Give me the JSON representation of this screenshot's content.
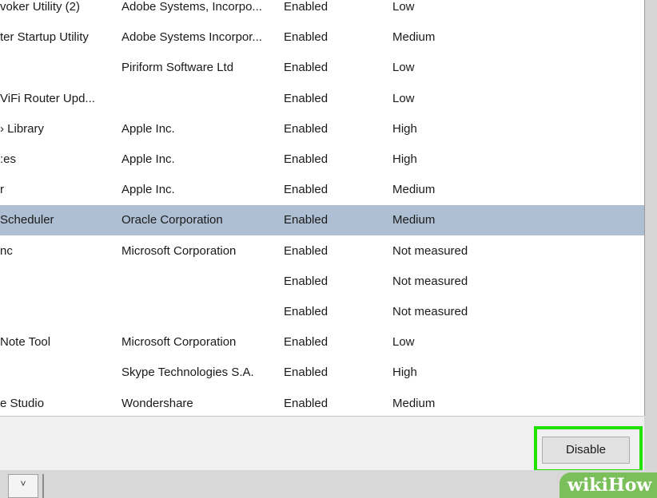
{
  "startup": {
    "rows": [
      {
        "name": "voker Utility (2)",
        "publisher": "Adobe Systems, Incorpo...",
        "status": "Enabled",
        "impact": "Low"
      },
      {
        "name": "ter Startup Utility",
        "publisher": "Adobe Systems Incorpor...",
        "status": "Enabled",
        "impact": "Medium"
      },
      {
        "name": "",
        "publisher": "Piriform Software Ltd",
        "status": "Enabled",
        "impact": "Low"
      },
      {
        "name": "ViFi Router Upd...",
        "publisher": "",
        "status": "Enabled",
        "impact": "Low"
      },
      {
        "name": "› Library",
        "publisher": "Apple Inc.",
        "status": "Enabled",
        "impact": "High"
      },
      {
        "name": ":es",
        "publisher": "Apple Inc.",
        "status": "Enabled",
        "impact": "High"
      },
      {
        "name": "r",
        "publisher": "Apple Inc.",
        "status": "Enabled",
        "impact": "Medium"
      },
      {
        "name": "Scheduler",
        "publisher": "Oracle Corporation",
        "status": "Enabled",
        "impact": "Medium"
      },
      {
        "name": "nc",
        "publisher": "Microsoft Corporation",
        "status": "Enabled",
        "impact": "Not measured"
      },
      {
        "name": "",
        "publisher": "",
        "status": "Enabled",
        "impact": "Not measured"
      },
      {
        "name": "",
        "publisher": "",
        "status": "Enabled",
        "impact": "Not measured"
      },
      {
        "name": "Note Tool",
        "publisher": "Microsoft Corporation",
        "status": "Enabled",
        "impact": "Low"
      },
      {
        "name": "",
        "publisher": "Skype Technologies S.A.",
        "status": "Enabled",
        "impact": "High"
      },
      {
        "name": "e Studio",
        "publisher": "Wondershare",
        "status": "Enabled",
        "impact": "Medium"
      }
    ],
    "selected_index": 7
  },
  "footer": {
    "disable_label": "Disable"
  },
  "taskbar": {
    "dropdown_glyph": "˅"
  },
  "watermark": {
    "part1": "wiki",
    "part2": "How"
  },
  "colors": {
    "selection": "#aebfd3",
    "highlight": "#22e000"
  }
}
